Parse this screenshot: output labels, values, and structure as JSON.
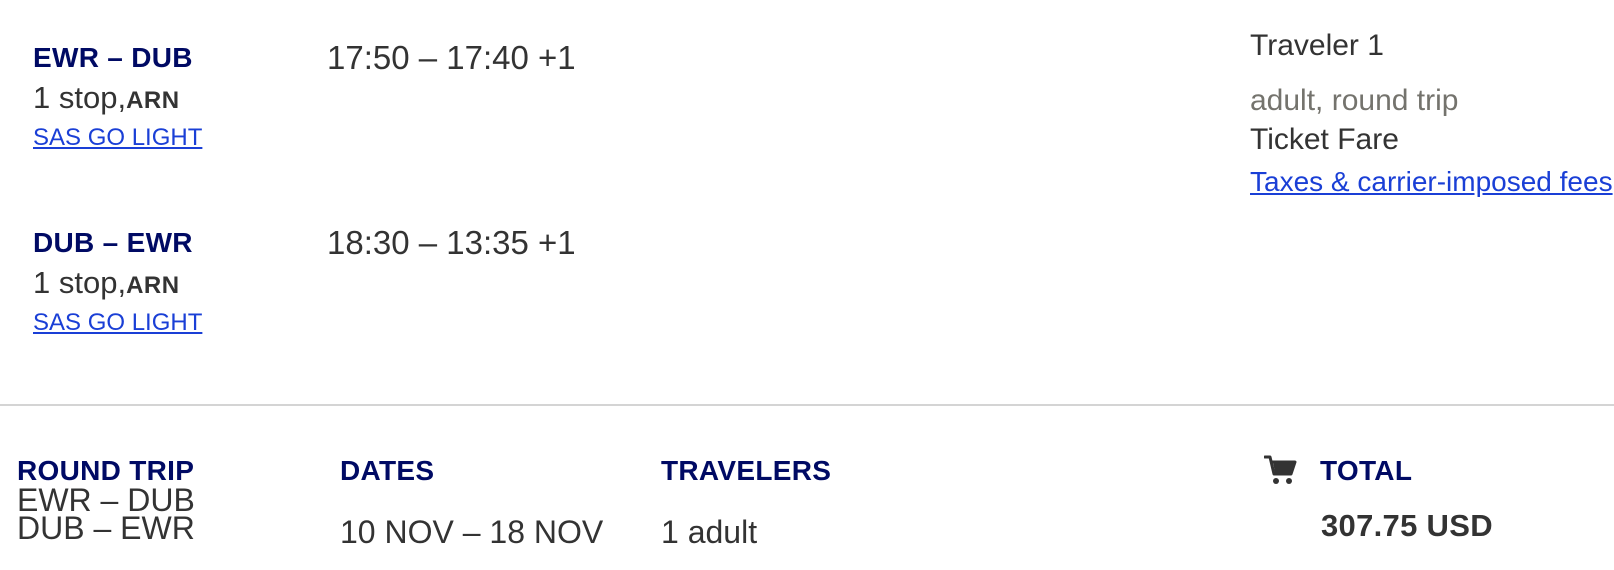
{
  "flights": [
    {
      "route": "EWR – DUB",
      "stops": "1 stop,",
      "via": "ARN",
      "fare": "SAS GO LIGHT",
      "time": "17:50 – 17:40 +1"
    },
    {
      "route": "DUB – EWR",
      "stops": "1 stop,",
      "via": "ARN",
      "fare": "SAS GO LIGHT",
      "time": "18:30 – 13:35 +1"
    }
  ],
  "traveler": {
    "title": "Traveler 1",
    "type": "adult, round trip",
    "ticket_fare": "Ticket Fare",
    "fees_link": "Taxes & carrier-imposed fees"
  },
  "summary": {
    "trip_label": "ROUND TRIP",
    "trip_routes": [
      "EWR – DUB",
      "DUB – EWR"
    ],
    "dates_label": "DATES",
    "dates_value": "10 NOV – 18 NOV",
    "travelers_label": "TRAVELERS",
    "travelers_value": "1 adult",
    "total_label": "TOTAL",
    "total_value": "307.75 USD",
    "cart_icon": "cart-icon"
  },
  "colors": {
    "heading_navy": "#000a64",
    "link_blue": "#1a3fd6",
    "body_text": "#333333",
    "muted_text": "#74736d",
    "divider": "#d4d4d4"
  }
}
